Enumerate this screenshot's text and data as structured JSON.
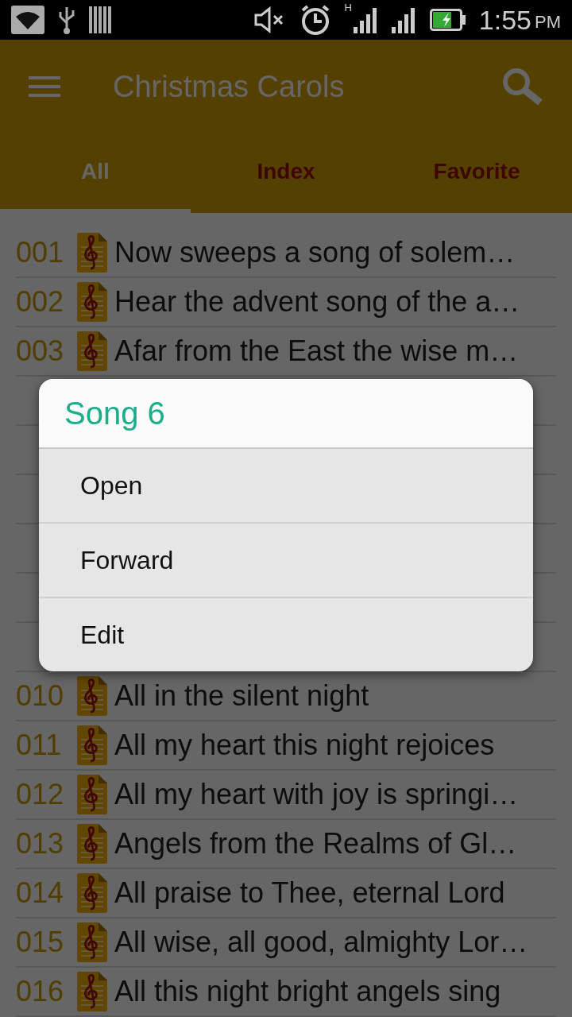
{
  "status_bar": {
    "time": "1:55",
    "ampm": "PM",
    "network_type": "H",
    "battery": {
      "level": 0.7,
      "charging": true
    }
  },
  "toolbar": {
    "title": "Christmas Carols"
  },
  "tabs": [
    {
      "label": "All",
      "selected": true
    },
    {
      "label": "Index",
      "selected": false
    },
    {
      "label": "Favorite",
      "selected": false
    }
  ],
  "songs": [
    {
      "kind": "song",
      "number": "001",
      "title": "Now sweeps a song of solem…"
    },
    {
      "kind": "song",
      "number": "002",
      "title": "Hear the advent song of the a…"
    },
    {
      "kind": "song",
      "number": "003",
      "title": "Afar from the East the wise m…"
    },
    {
      "kind": "covered"
    },
    {
      "kind": "covered"
    },
    {
      "kind": "covered"
    },
    {
      "kind": "covered"
    },
    {
      "kind": "covered"
    },
    {
      "kind": "covered"
    },
    {
      "kind": "song",
      "number": "010",
      "title": "All in the silent night"
    },
    {
      "kind": "song",
      "number": "011",
      "title": "All my heart this night rejoices"
    },
    {
      "kind": "song",
      "number": "012",
      "title": "All my heart with joy is springi…"
    },
    {
      "kind": "song",
      "number": "013",
      "title": "Angels from the Realms of Gl…"
    },
    {
      "kind": "song",
      "number": "014",
      "title": "All praise to Thee, eternal Lord"
    },
    {
      "kind": "song",
      "number": "015",
      "title": "All wise, all good, almighty Lor…"
    },
    {
      "kind": "song",
      "number": "016",
      "title": "All this night bright angels sing"
    }
  ],
  "dialog": {
    "title": "Song 6",
    "items": [
      "Open",
      "Forward",
      "Edit"
    ]
  }
}
